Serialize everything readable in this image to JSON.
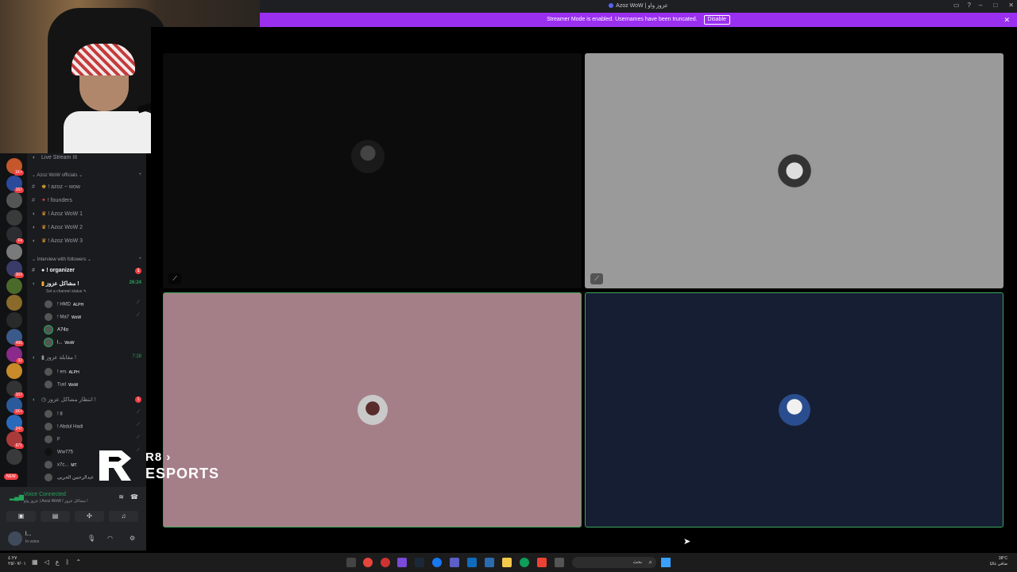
{
  "window": {
    "title": "Azoz WoW | عزوز واو"
  },
  "banner": {
    "message": "Streamer Mode is enabled. Usernames have been truncated.",
    "disable_label": "Disable"
  },
  "sidebar": {
    "top_channel": "Live Stream III",
    "category_officials": "Azoz WoW officials",
    "officials_channels": [
      {
        "label": "! azoz ~ wow",
        "type": "text"
      },
      {
        "label": "! founders",
        "type": "text"
      },
      {
        "label": "! Azoz WoW 1",
        "type": "voice"
      },
      {
        "label": "! Azoz WoW 2",
        "type": "voice"
      },
      {
        "label": "! Azoz WoW 3",
        "type": "voice"
      }
    ],
    "category_interview": "Interview with followers",
    "organizer_channel": "! organizer",
    "organizer_unread": "1",
    "voice_channel_1": "مشاكل عزوز !",
    "voice_channel_1_status": "Set a channel status",
    "voice_channel_1_time": "26:24",
    "voice_channel_1_users": [
      {
        "name": "! HMD",
        "tag": "ALPH"
      },
      {
        "name": "! Ma7",
        "tag": "WoW"
      },
      {
        "name": "A74o",
        "tag": ""
      },
      {
        "name": "l...",
        "tag": "WoW"
      }
    ],
    "voice_channel_2": "مقابلة عزوز !",
    "voice_channel_2_time": "7:28",
    "voice_channel_2_users": [
      {
        "name": "! ers",
        "tag": "ALPH"
      },
      {
        "name": "Tuxl",
        "tag": "WoW"
      }
    ],
    "voice_channel_3": "انتظار مشاكل عزوز !",
    "voice_channel_3_unread": "1",
    "voice_channel_3_users": [
      {
        "name": "! 8",
        "tag": ""
      },
      {
        "name": "! Abdul Hadi",
        "tag": ""
      },
      {
        "name": "F",
        "tag": ""
      },
      {
        "name": "Ww775",
        "tag": ""
      },
      {
        "name": "x7c...",
        "tag": "MT"
      },
      {
        "name": "عبدالرحمن الحربي",
        "tag": ""
      }
    ]
  },
  "servers": [
    {
      "badge": "1K+",
      "color": "#c4572b"
    },
    {
      "badge": "167",
      "color": "#2b4a9a"
    },
    {
      "badge": "",
      "color": "#555555"
    },
    {
      "badge": "",
      "color": "#3a3a3a"
    },
    {
      "badge": "Fs",
      "color": "#2b2d31"
    },
    {
      "badge": "",
      "color": "#7a7a7a"
    },
    {
      "badge": "369",
      "color": "#3b3b6a"
    },
    {
      "badge": "",
      "color": "#4a6a2a"
    },
    {
      "badge": "",
      "color": "#8a6a2a"
    },
    {
      "badge": "",
      "color": "#2a2a2a"
    },
    {
      "badge": "496",
      "color": "#3a5a8a"
    },
    {
      "badge": "32",
      "color": "#8a2a8a"
    },
    {
      "badge": "",
      "color": "#c98a2a"
    },
    {
      "badge": "107",
      "color": "#333333"
    },
    {
      "badge": "1K+",
      "color": "#2a5a9a"
    },
    {
      "badge": "247",
      "color": "#2a6aba"
    },
    {
      "badge": "671",
      "color": "#aa3a3a"
    },
    {
      "badge": "",
      "color": "#3a3a3a"
    }
  ],
  "server_new_label": "NEW",
  "voice_panel": {
    "status": "Voice Connected",
    "subtitle": "عزوز واو | Azoz WoW / مشاكل عزوز !",
    "user_name": "l...",
    "user_status": "In voice"
  },
  "watermark": {
    "line1": "R8 ›",
    "line2": "ESPORTS"
  },
  "taskbar": {
    "time": "٤:٢٧",
    "date": "٢٥/٠٧/٠١",
    "search_placeholder": "بحث",
    "weather_temp": "38°C",
    "weather_desc": "صافي غالبًا"
  },
  "colors": {
    "accent_banner": "#9b2ff0",
    "speaking_border": "#3ba55c",
    "tile_bottom_left": "#a57f87",
    "tile_bottom_right": "#161e33",
    "tile_top_right": "#9a9a9a"
  }
}
